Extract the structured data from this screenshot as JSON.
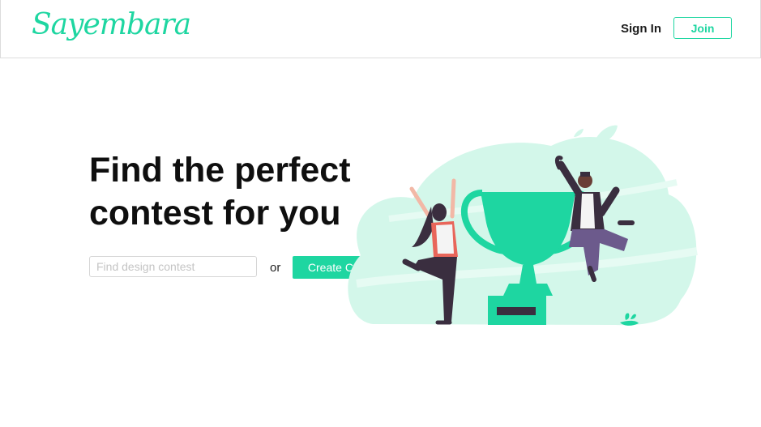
{
  "header": {
    "logo_text": "Sayembara",
    "signin_label": "Sign In",
    "join_label": "Join"
  },
  "hero": {
    "title_line1": "Find the perfect",
    "title_line2": "contest for you",
    "search_placeholder": "Find design contest",
    "or_text": "or",
    "create_label": "Create Contest"
  },
  "colors": {
    "accent": "#1ed6a1",
    "accent_light": "#d3f7ea",
    "figure_dark": "#3a2e3f",
    "figure_purple": "#6c5a8c",
    "figure_red": "#e8665a"
  },
  "illustration": {
    "icon": "celebration-trophy-illustration"
  }
}
